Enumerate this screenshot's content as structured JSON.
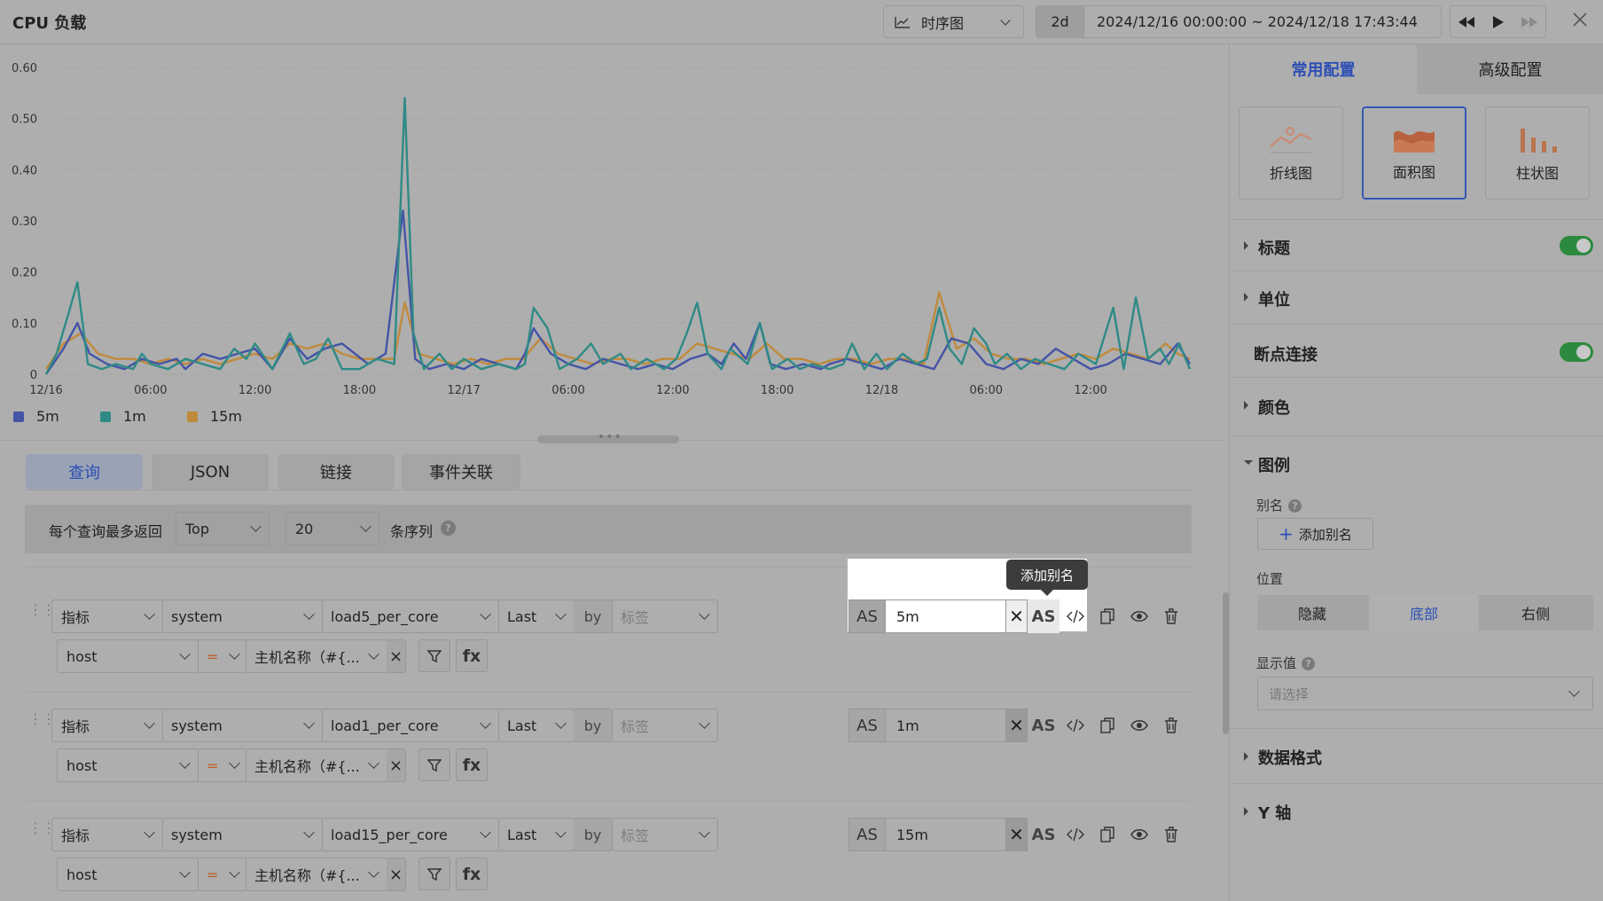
{
  "header": {
    "title": "CPU 负载",
    "view_type": "时序图",
    "range_preset": "2d",
    "time_range": "2024/12/16 00:00:00 ~ 2024/12/18 17:43:44"
  },
  "chart_data": {
    "type": "line",
    "title": "",
    "xlabel": "",
    "ylabel": "",
    "ylim": [
      0,
      0.6
    ],
    "y_ticks": [
      "0.60",
      "0.50",
      "0.40",
      "0.30",
      "0.20",
      "0.10",
      "0"
    ],
    "x_tick_labels": [
      "12/16",
      "06:00",
      "12:00",
      "18:00",
      "12/17",
      "06:00",
      "12:00",
      "18:00",
      "12/18",
      "06:00",
      "12:00"
    ],
    "x_tick_hours": [
      0,
      6,
      12,
      18,
      24,
      30,
      36,
      42,
      48,
      54,
      60
    ],
    "x_range_hours": [
      0,
      65.7
    ],
    "grid": true,
    "legend_position": "bottom",
    "series": [
      {
        "name": "5m",
        "color": "#4454a6",
        "points": [
          [
            0,
            0
          ],
          [
            1,
            0.05
          ],
          [
            1.8,
            0.1
          ],
          [
            2.5,
            0.04
          ],
          [
            3.5,
            0.02
          ],
          [
            4.5,
            0.01
          ],
          [
            5.5,
            0.03
          ],
          [
            6.5,
            0.02
          ],
          [
            7.5,
            0.03
          ],
          [
            8,
            0.01
          ],
          [
            9,
            0.04
          ],
          [
            10,
            0.03
          ],
          [
            11,
            0.04
          ],
          [
            12,
            0.05
          ],
          [
            13,
            0.01
          ],
          [
            14,
            0.07
          ],
          [
            15,
            0.03
          ],
          [
            16,
            0.05
          ],
          [
            17,
            0.06
          ],
          [
            18.5,
            0.02
          ],
          [
            19.5,
            0.04
          ],
          [
            20.5,
            0.32
          ],
          [
            21.2,
            0.03
          ],
          [
            22,
            0.01
          ],
          [
            23,
            0.02
          ],
          [
            24,
            0.01
          ],
          [
            25,
            0.03
          ],
          [
            26,
            0.02
          ],
          [
            27,
            0.01
          ],
          [
            27.5,
            0.04
          ],
          [
            28,
            0.09
          ],
          [
            29,
            0.04
          ],
          [
            30,
            0.02
          ],
          [
            31,
            0.01
          ],
          [
            32,
            0.03
          ],
          [
            33,
            0.02
          ],
          [
            34,
            0.01
          ],
          [
            35,
            0.02
          ],
          [
            36,
            0.01
          ],
          [
            37,
            0.03
          ],
          [
            38,
            0.04
          ],
          [
            38.8,
            0.02
          ],
          [
            39.5,
            0.06
          ],
          [
            40.2,
            0.03
          ],
          [
            41,
            0.1
          ],
          [
            41.6,
            0.02
          ],
          [
            42.5,
            0.01
          ],
          [
            43.5,
            0.02
          ],
          [
            44.5,
            0.01
          ],
          [
            45,
            0.02
          ],
          [
            46,
            0.03
          ],
          [
            47,
            0.02
          ],
          [
            48,
            0.01
          ],
          [
            49,
            0.03
          ],
          [
            50,
            0.02
          ],
          [
            51,
            0.01
          ],
          [
            52,
            0.07
          ],
          [
            53,
            0.06
          ],
          [
            54,
            0.02
          ],
          [
            55,
            0.01
          ],
          [
            56,
            0.03
          ],
          [
            57,
            0.02
          ],
          [
            58,
            0.05
          ],
          [
            59,
            0.03
          ],
          [
            60,
            0.01
          ],
          [
            61,
            0.02
          ],
          [
            62,
            0.04
          ],
          [
            63,
            0.03
          ],
          [
            64,
            0.02
          ],
          [
            65,
            0.06
          ],
          [
            65.7,
            0.02
          ]
        ]
      },
      {
        "name": "1m",
        "color": "#2f8a86",
        "points": [
          [
            0,
            0
          ],
          [
            0.6,
            0.04
          ],
          [
            1.3,
            0.12
          ],
          [
            1.8,
            0.18
          ],
          [
            2.4,
            0.02
          ],
          [
            3.2,
            0.01
          ],
          [
            4,
            0.02
          ],
          [
            5,
            0.01
          ],
          [
            5.5,
            0.04
          ],
          [
            6,
            0.02
          ],
          [
            7,
            0.01
          ],
          [
            8,
            0.03
          ],
          [
            9,
            0.02
          ],
          [
            10,
            0.01
          ],
          [
            10.8,
            0.05
          ],
          [
            11.5,
            0.03
          ],
          [
            12,
            0.06
          ],
          [
            13,
            0.01
          ],
          [
            14,
            0.08
          ],
          [
            14.8,
            0.02
          ],
          [
            15.5,
            0.03
          ],
          [
            16.2,
            0.07
          ],
          [
            17,
            0.01
          ],
          [
            18,
            0.01
          ],
          [
            19,
            0.03
          ],
          [
            20,
            0.02
          ],
          [
            20.6,
            0.54
          ],
          [
            21.1,
            0.08
          ],
          [
            21.7,
            0.01
          ],
          [
            22.6,
            0.04
          ],
          [
            23.3,
            0.01
          ],
          [
            24,
            0.03
          ],
          [
            25,
            0.01
          ],
          [
            26,
            0.02
          ],
          [
            27,
            0.01
          ],
          [
            27.5,
            0.02
          ],
          [
            28,
            0.13
          ],
          [
            28.8,
            0.09
          ],
          [
            29.5,
            0.01
          ],
          [
            30.5,
            0.03
          ],
          [
            31.3,
            0.06
          ],
          [
            32,
            0.02
          ],
          [
            33,
            0.04
          ],
          [
            33.6,
            0.01
          ],
          [
            34.5,
            0.03
          ],
          [
            35.5,
            0.01
          ],
          [
            36.2,
            0.03
          ],
          [
            36.8,
            0.08
          ],
          [
            37.4,
            0.14
          ],
          [
            38,
            0.04
          ],
          [
            38.8,
            0.01
          ],
          [
            39.3,
            0.05
          ],
          [
            40.3,
            0.02
          ],
          [
            41,
            0.1
          ],
          [
            41.7,
            0.01
          ],
          [
            42.6,
            0.03
          ],
          [
            43.3,
            0.01
          ],
          [
            44,
            0.02
          ],
          [
            45,
            0.01
          ],
          [
            45.8,
            0.02
          ],
          [
            46.3,
            0.06
          ],
          [
            47,
            0.01
          ],
          [
            47.7,
            0.04
          ],
          [
            48.3,
            0.01
          ],
          [
            49.2,
            0.04
          ],
          [
            50,
            0.02
          ],
          [
            50.6,
            0.03
          ],
          [
            51.3,
            0.13
          ],
          [
            51.9,
            0.05
          ],
          [
            52.6,
            0.02
          ],
          [
            53.3,
            0.09
          ],
          [
            54,
            0.06
          ],
          [
            54.5,
            0.02
          ],
          [
            55.2,
            0.04
          ],
          [
            56,
            0.01
          ],
          [
            56.8,
            0.03
          ],
          [
            57.6,
            0.02
          ],
          [
            58.5,
            0.01
          ],
          [
            59.3,
            0.04
          ],
          [
            60.3,
            0.02
          ],
          [
            61.3,
            0.13
          ],
          [
            61.9,
            0.01
          ],
          [
            62.6,
            0.15
          ],
          [
            63.3,
            0.03
          ],
          [
            64,
            0.05
          ],
          [
            64.5,
            0.02
          ],
          [
            65.1,
            0.06
          ],
          [
            65.7,
            0.01
          ]
        ]
      },
      {
        "name": "15m",
        "color": "#c08a3c",
        "points": [
          [
            0,
            0.01
          ],
          [
            1,
            0.06
          ],
          [
            2,
            0.08
          ],
          [
            3,
            0.04
          ],
          [
            4,
            0.03
          ],
          [
            5,
            0.03
          ],
          [
            6,
            0.02
          ],
          [
            7,
            0.03
          ],
          [
            8,
            0.02
          ],
          [
            9,
            0.03
          ],
          [
            10,
            0.02
          ],
          [
            11,
            0.03
          ],
          [
            12,
            0.04
          ],
          [
            13,
            0.03
          ],
          [
            14,
            0.06
          ],
          [
            15,
            0.05
          ],
          [
            16,
            0.06
          ],
          [
            17,
            0.04
          ],
          [
            18,
            0.03
          ],
          [
            19,
            0.03
          ],
          [
            20,
            0.03
          ],
          [
            20.6,
            0.14
          ],
          [
            21.4,
            0.04
          ],
          [
            22.4,
            0.03
          ],
          [
            23.4,
            0.02
          ],
          [
            24.4,
            0.03
          ],
          [
            25.4,
            0.02
          ],
          [
            26.4,
            0.03
          ],
          [
            27.4,
            0.03
          ],
          [
            28.4,
            0.07
          ],
          [
            29.4,
            0.04
          ],
          [
            30.4,
            0.03
          ],
          [
            31.4,
            0.02
          ],
          [
            32.4,
            0.03
          ],
          [
            33.4,
            0.03
          ],
          [
            34.4,
            0.02
          ],
          [
            35.4,
            0.03
          ],
          [
            36.4,
            0.03
          ],
          [
            37.4,
            0.06
          ],
          [
            38.4,
            0.05
          ],
          [
            39.4,
            0.04
          ],
          [
            40.4,
            0.03
          ],
          [
            41.4,
            0.06
          ],
          [
            42.4,
            0.03
          ],
          [
            43.4,
            0.03
          ],
          [
            44.4,
            0.02
          ],
          [
            45.4,
            0.03
          ],
          [
            46.4,
            0.03
          ],
          [
            47.4,
            0.02
          ],
          [
            48.4,
            0.03
          ],
          [
            49.4,
            0.03
          ],
          [
            50.4,
            0.02
          ],
          [
            51.3,
            0.16
          ],
          [
            52.3,
            0.05
          ],
          [
            53.3,
            0.07
          ],
          [
            54.3,
            0.04
          ],
          [
            55.3,
            0.03
          ],
          [
            56.3,
            0.03
          ],
          [
            57.3,
            0.02
          ],
          [
            58.3,
            0.03
          ],
          [
            59.3,
            0.04
          ],
          [
            60.3,
            0.03
          ],
          [
            61.3,
            0.05
          ],
          [
            62.3,
            0.04
          ],
          [
            63.3,
            0.03
          ],
          [
            64.3,
            0.06
          ],
          [
            65,
            0.04
          ],
          [
            65.7,
            0.03
          ]
        ]
      }
    ]
  },
  "legend": [
    {
      "name": "5m",
      "color": "#4454a6"
    },
    {
      "name": "1m",
      "color": "#2f8a86"
    },
    {
      "name": "15m",
      "color": "#c08a3c"
    }
  ],
  "tabs": [
    {
      "label": "查询"
    },
    {
      "label": "JSON"
    },
    {
      "label": "链接"
    },
    {
      "label": "事件关联"
    }
  ],
  "limit": {
    "label": "每个查询最多返回",
    "mode": "Top",
    "count": "20",
    "suffix": "条序列"
  },
  "queries": [
    {
      "source": "指标",
      "measurement": "system",
      "field": "load5_per_core",
      "agg": "Last",
      "by": "by",
      "group_placeholder": "标签",
      "filter_key": "host",
      "filter_op": "=",
      "filter_value": "主机名称（#{...",
      "alias": "5m"
    },
    {
      "source": "指标",
      "measurement": "system",
      "field": "load1_per_core",
      "agg": "Last",
      "by": "by",
      "group_placeholder": "标签",
      "filter_key": "host",
      "filter_op": "=",
      "filter_value": "主机名称（#{...",
      "alias": "1m"
    },
    {
      "source": "指标",
      "measurement": "system",
      "field": "load15_per_core",
      "agg": "Last",
      "by": "by",
      "group_placeholder": "标签",
      "filter_key": "host",
      "filter_op": "=",
      "filter_value": "主机名称（#{...",
      "alias": "15m"
    }
  ],
  "alias_labels": {
    "as": "AS",
    "fx": "fx"
  },
  "tooltip": "添加别名",
  "panel": {
    "tabs": [
      "常用配置",
      "高级配置"
    ],
    "chart_types": [
      "折线图",
      "面积图",
      "柱状图"
    ],
    "sections": {
      "title": "标题",
      "unit": "单位",
      "connect": "断点连接",
      "color": "颜色",
      "legend": "图例",
      "format": "数据格式",
      "yaxis": "Y 轴"
    },
    "legend_config": {
      "alias_label": "别名",
      "add_alias": "添加别名",
      "position_label": "位置",
      "positions": [
        "隐藏",
        "底部",
        "右侧"
      ],
      "value_label": "显示值",
      "value_placeholder": "请选择"
    },
    "accent_color": "#2c4fb5",
    "toggle_color": "#2b8a3e"
  }
}
